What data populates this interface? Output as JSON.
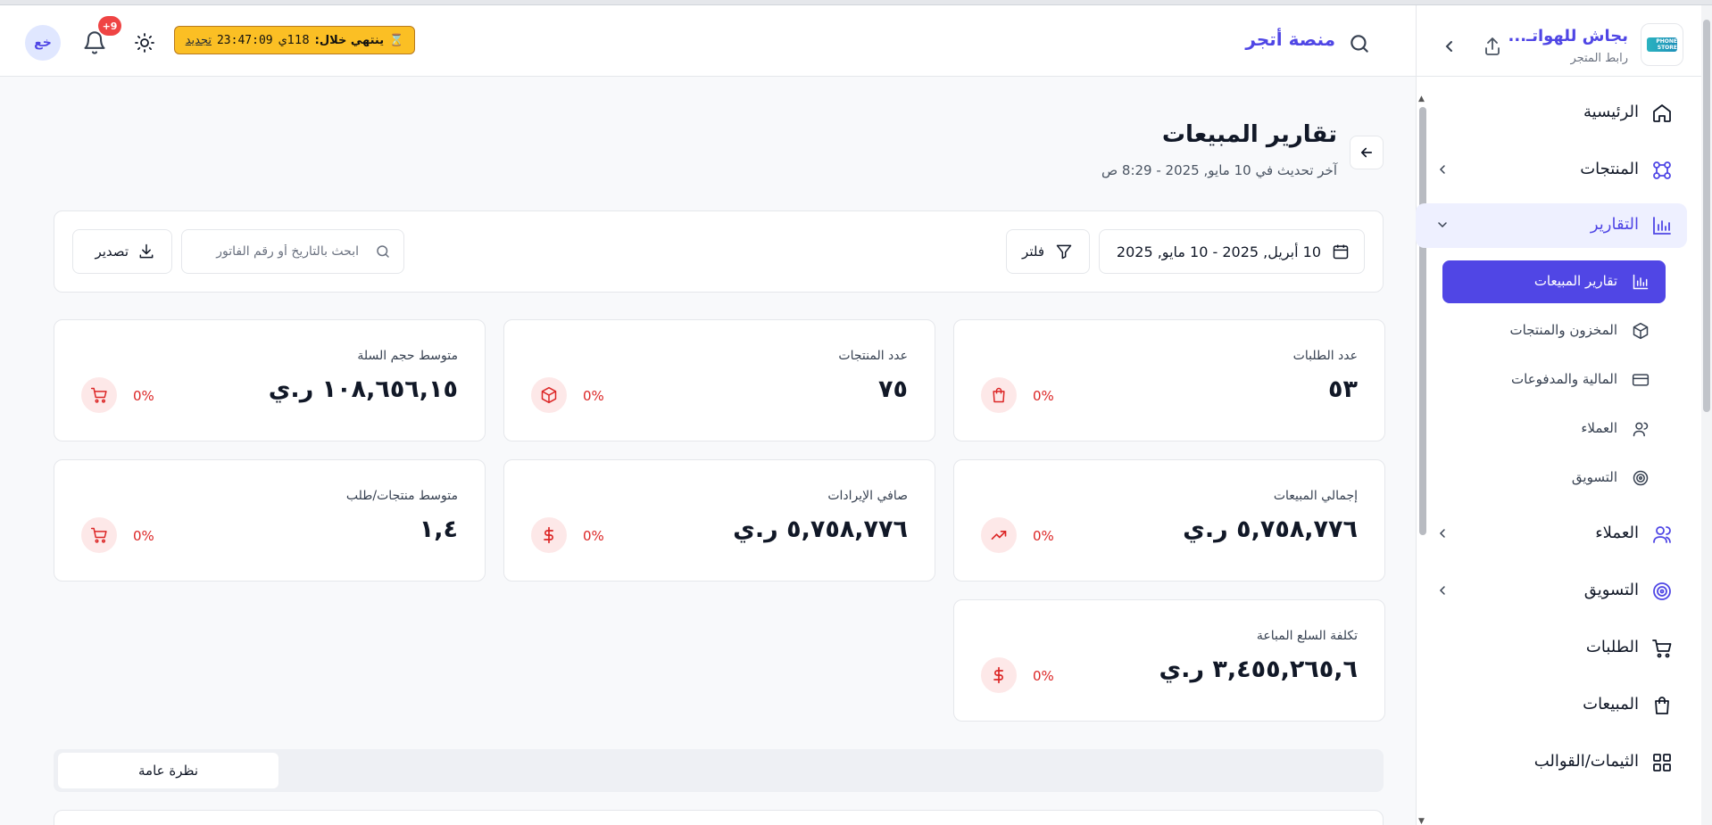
{
  "header": {
    "avatar_initials": "خع",
    "notifications_badge": "+9",
    "trial": {
      "prefix": "ينتهي خلال:",
      "days": "118ي",
      "time": "23:47:09",
      "renew": "تجديد"
    },
    "brand": "منصة أتجر"
  },
  "store": {
    "logo_text": "PHONE STORE",
    "name": "بجاش للهواتـ...",
    "link_label": "رابط المتجر"
  },
  "sidebar": {
    "items": [
      {
        "label": "الرئيسية",
        "icon": "home-icon"
      },
      {
        "label": "المنتجات",
        "icon": "products-icon"
      },
      {
        "label": "التقارير",
        "icon": "chart-icon"
      },
      {
        "label": "العملاء",
        "icon": "users-icon"
      },
      {
        "label": "التسويق",
        "icon": "target-icon"
      },
      {
        "label": "الطلبات",
        "icon": "cart-icon"
      },
      {
        "label": "المبيعات",
        "icon": "bag-icon"
      },
      {
        "label": "الثيمات/القوالب",
        "icon": "grid-icon"
      }
    ],
    "reports_sub": [
      {
        "label": "تقارير المبيعات",
        "icon": "chart-icon"
      },
      {
        "label": "المخزون والمنتجات",
        "icon": "box-icon"
      },
      {
        "label": "المالية والمدفوعات",
        "icon": "card-icon"
      },
      {
        "label": "العملاء",
        "icon": "user-icon"
      },
      {
        "label": "التسويق",
        "icon": "target-icon"
      }
    ]
  },
  "page": {
    "title": "تقارير المبيعات",
    "updated": "آخر تحديث في 10 مايو, 2025 - 8:29 ص"
  },
  "filters": {
    "date_range": "10 أبريل, 2025 - 10 مايو, 2025",
    "filter_label": "فلتر",
    "search_placeholder": "ابحث بالتاريخ أو رقم الفاتور",
    "search_value": "",
    "export_label": "تصدير"
  },
  "stats": [
    {
      "title": "عدد الطلبات",
      "value": "٥٣",
      "change": "0%",
      "icon": "bag-icon"
    },
    {
      "title": "عدد المنتجات",
      "value": "٧٥",
      "change": "0%",
      "icon": "box-icon"
    },
    {
      "title": "متوسط حجم السلة",
      "value": "١٠٨,٦٥٦,١٥ ر.ي",
      "change": "0%",
      "icon": "cart-icon"
    },
    {
      "title": "إجمالي المبيعات",
      "value": "٥,٧٥٨,٧٧٦ ر.ي",
      "change": "0%",
      "icon": "trend-up-icon"
    },
    {
      "title": "صافي الإيرادات",
      "value": "٥,٧٥٨,٧٧٦ ر.ي",
      "change": "0%",
      "icon": "dollar-icon"
    },
    {
      "title": "متوسط منتجات/طلب",
      "value": "١,٤",
      "change": "0%",
      "icon": "cart-icon"
    },
    {
      "title": "تكلفة السلع المباعة",
      "value": "٣,٤٥٥,٢٦٥,٦ ر.ي",
      "change": "0%",
      "icon": "dollar-icon"
    }
  ],
  "tabs": [
    {
      "label": "نظرة عامة"
    }
  ],
  "colors": {
    "accent": "#4f46e5",
    "danger": "#dc2626",
    "trial_bg": "#fbbf24"
  }
}
